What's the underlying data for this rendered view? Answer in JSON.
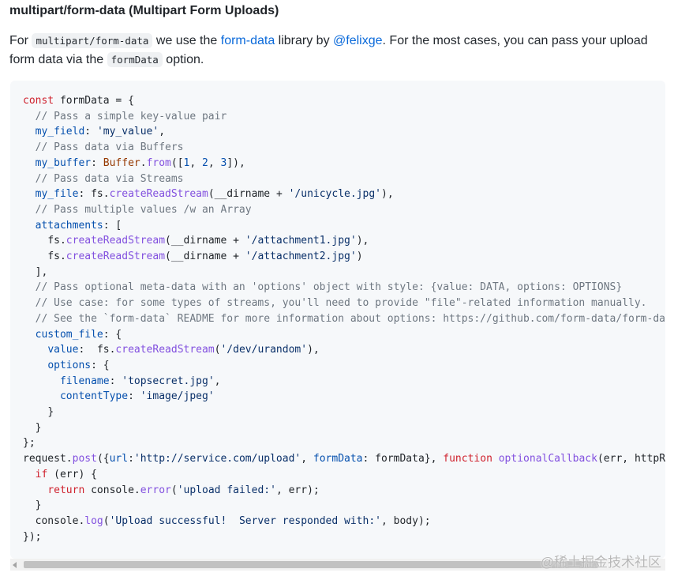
{
  "heading": "multipart/form-data (Multipart Form Uploads)",
  "intro": {
    "for": "For",
    "code_content_type": "multipart/form-data",
    "we_use_the": "we use the",
    "lib_link": "form-data",
    "library_by": "library by",
    "author_link": "@felixge",
    "sentence_rest": ". For the most cases, you can pass your upload form data via the",
    "code_option": "formData",
    "option_word": "option."
  },
  "code": {
    "language": "javascript",
    "lines": [
      "const formData = {",
      "  // Pass a simple key-value pair",
      "  my_field: 'my_value',",
      "  // Pass data via Buffers",
      "  my_buffer: Buffer.from([1, 2, 3]),",
      "  // Pass data via Streams",
      "  my_file: fs.createReadStream(__dirname + '/unicycle.jpg'),",
      "  // Pass multiple values /w an Array",
      "  attachments: [",
      "    fs.createReadStream(__dirname + '/attachment1.jpg'),",
      "    fs.createReadStream(__dirname + '/attachment2.jpg')",
      "  ],",
      "  // Pass optional meta-data with an 'options' object with style: {value: DATA, options: OPTIONS}",
      "  // Use case: for some types of streams, you'll need to provide \"file\"-related information manually.",
      "  // See the `form-data` README for more information about options: https://github.com/form-data/form-data",
      "  custom_file: {",
      "    value:  fs.createReadStream('/dev/urandom'),",
      "    options: {",
      "      filename: 'topsecret.jpg',",
      "      contentType: 'image/jpeg'",
      "    }",
      "  }",
      "};",
      "request.post({url:'http://service.com/upload', formData: formData}, function optionalCallback(err, httpRespon",
      "  if (err) {",
      "    return console.error('upload failed:', err);",
      "  }",
      "  console.log('Upload successful!  Server responded with:', body);",
      "});"
    ]
  },
  "watermark": "@稀土掘金技术社区",
  "colors": {
    "link": "#0969da",
    "code_background": "#f6f8fa",
    "keyword": "#cf222e",
    "comment": "#6e7781",
    "string": "#0a3069",
    "property": "#0550ae",
    "function": "#8250df"
  }
}
